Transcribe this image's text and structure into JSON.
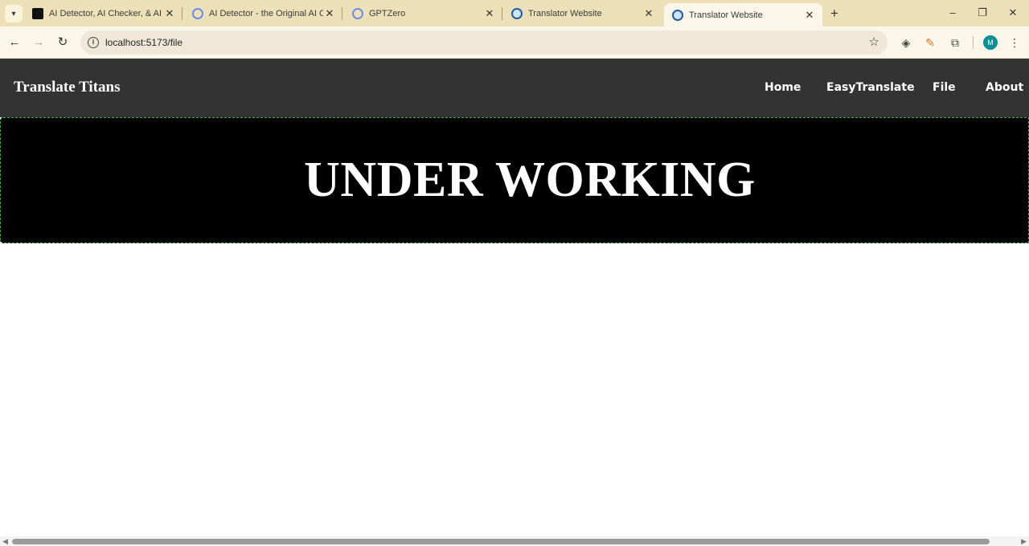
{
  "browser": {
    "tabs": [
      {
        "title": "AI Detector, AI Checker, & AI Hu",
        "favicon": "zerogpt-icon",
        "active": false
      },
      {
        "title": "AI Detector - the Original AI Ch",
        "favicon": "gptzero-icon",
        "active": false
      },
      {
        "title": "GPTZero",
        "favicon": "gptzero-icon",
        "active": false
      },
      {
        "title": "Translator Website",
        "favicon": "globe-icon",
        "active": false
      },
      {
        "title": "Translator Website",
        "favicon": "globe-icon",
        "active": true
      }
    ],
    "url": "localhost:5173/file",
    "profile_initial": "M",
    "accent_color": "#ede0b9"
  },
  "site": {
    "brand": "Translate Titans",
    "nav": [
      {
        "label": "Home"
      },
      {
        "label": "EasyTranslate"
      },
      {
        "label": "File"
      },
      {
        "label": "About"
      }
    ],
    "hero_text": "UNDER WORKING",
    "navbar_color": "#333333",
    "hero_color": "#000000"
  }
}
